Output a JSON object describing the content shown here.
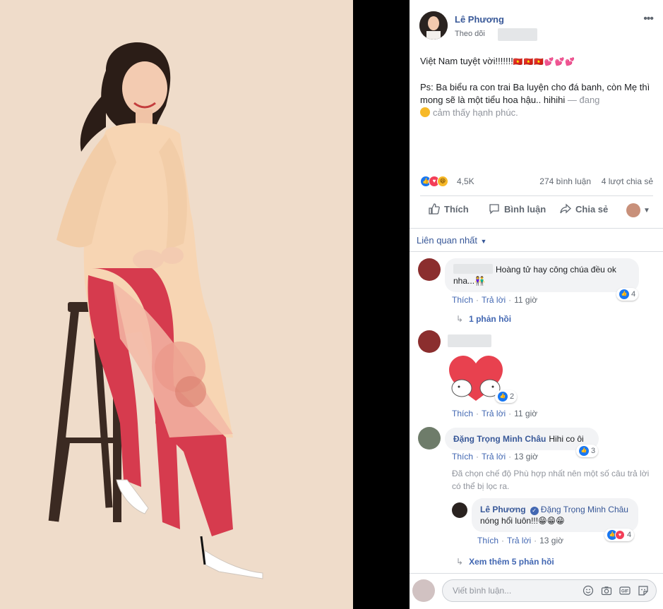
{
  "colors": {
    "link": "#385898",
    "accent": "#1877f2",
    "love": "#f33e58",
    "muted": "#606770",
    "bubble": "#f2f3f5",
    "photo_bg": "#efdcca"
  },
  "post": {
    "author": "Lê Phương",
    "follow": "Theo dõi",
    "more_icon": "more-icon",
    "text_line1": "Việt Nam tuyệt vời!!!!!!!",
    "text_emojis": "🇻🇳🇻🇳🇻🇳💕💕💕",
    "text_line2": "Ps: Ba biểu ra con trai Ba luyện cho đá banh, còn Mẹ thì mong sẽ là một tiểu hoa hậu.. hihihi",
    "feeling_prefix": "— đang",
    "feeling_text": "cảm thấy hạnh phúc."
  },
  "stats": {
    "reactions": "4,5K",
    "comments": "274 bình luận",
    "shares": "4 lượt chia sẻ"
  },
  "actions": {
    "like": "Thích",
    "comment": "Bình luận",
    "share": "Chia sẻ"
  },
  "sort": {
    "label": "Liên quan nhất"
  },
  "comments": [
    {
      "name": "",
      "text": "Hoàng tử hay công chúa đều ok nha...👫",
      "like": "Thích",
      "reply": "Trả lời",
      "time": "11 giờ",
      "reactions": "4",
      "replies_link": "1 phản hồi"
    },
    {
      "name": "",
      "text": "",
      "like": "Thích",
      "reply": "Trả lời",
      "time": "11 giờ",
      "reactions": "2"
    },
    {
      "name": "Đặng Trọng Minh Châu",
      "text": "Hihi co ôi",
      "like": "Thích",
      "reply": "Trả lời",
      "time": "13 giờ",
      "reactions": "3"
    }
  ],
  "notice": "Đã chọn chế độ Phù hợp nhất nên một số câu trả lời có thể bị lọc ra.",
  "reply": {
    "name": "Lê Phương",
    "mention": "Đặng Trọng Minh Châu",
    "text": "nóng hổi luôn!!!😁😁😁",
    "like": "Thích",
    "reply": "Trả lời",
    "time": "13 giờ",
    "reactions": "4"
  },
  "more_replies": "Xem thêm 5 phản hồi",
  "composer": {
    "placeholder": "Viết bình luận..."
  }
}
